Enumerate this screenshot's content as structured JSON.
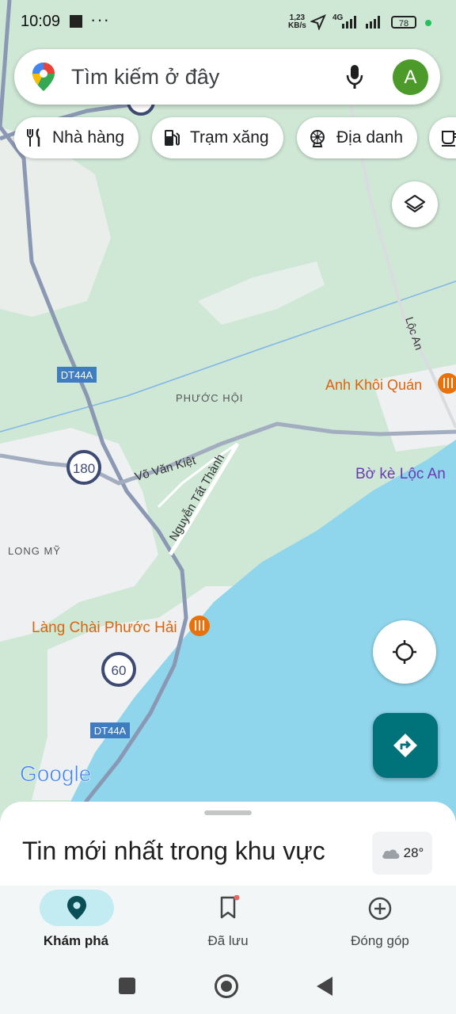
{
  "status_bar": {
    "time": "10:09",
    "overflow": "···",
    "speed_value": "1,23",
    "speed_unit": "KB/s",
    "network": "4G",
    "battery": "78"
  },
  "search": {
    "placeholder": "Tìm kiếm ở đây",
    "avatar_letter": "A"
  },
  "chips": [
    {
      "label": "Nhà hàng",
      "icon": "restaurant-icon"
    },
    {
      "label": "Trạm xăng",
      "icon": "gas-station-icon"
    },
    {
      "label": "Địa danh",
      "icon": "attraction-icon"
    },
    {
      "label": "",
      "icon": "cafe-icon"
    }
  ],
  "map": {
    "road_labels": {
      "dt44a_top": "DT44A",
      "dt44a_bottom": "DT44A",
      "route_180": "180",
      "route_60": "60",
      "vo_van_kiet": "Võ Văn Kiệt",
      "nguyen_tat_thanh": "Nguyễn Tất Thành",
      "loc_an": "Lộc An"
    },
    "areas": {
      "phuoc_hoi": "PHƯỚC HỘI",
      "long_my": "LONG MỸ"
    },
    "places": {
      "anh_khoi_quan": "Anh Khôi Quán",
      "bo_ke_loc_an": "Bờ kè Lộc An",
      "lang_chai": "Làng Chài Phước Hải"
    },
    "google_logo": "Google",
    "colors": {
      "land": "#cfe7d5",
      "water": "#8fd6ec",
      "urban": "#eef0f1",
      "road": "#8b98b3",
      "poi": "#e8710a"
    }
  },
  "sheet": {
    "title": "Tin mới nhất trong khu vực",
    "temperature": "28°"
  },
  "bottom_nav": [
    {
      "label": "Khám phá",
      "active": true
    },
    {
      "label": "Đã lưu",
      "active": false
    },
    {
      "label": "Đóng góp",
      "active": false
    }
  ]
}
